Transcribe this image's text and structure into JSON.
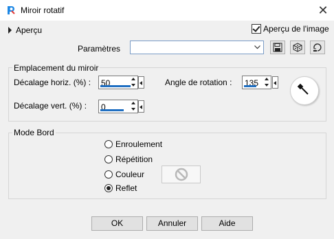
{
  "window": {
    "title": "Miroir rotatif"
  },
  "preview": {
    "label": "Aperçu",
    "image_preview_label": "Aperçu de l'image",
    "image_preview_checked": true
  },
  "parameters": {
    "label": "Paramètres",
    "value": ""
  },
  "mirror_group": {
    "title": "Emplacement du miroir",
    "horiz_label": "Décalage horiz. (%) :",
    "horiz_value": "50",
    "vert_label": "Décalage vert. (%) :",
    "vert_value": "0",
    "angle_label": "Angle de rotation :",
    "angle_value": "135"
  },
  "edge_group": {
    "title": "Mode Bord",
    "options": [
      "Enroulement",
      "Répétition",
      "Couleur",
      "Reflet"
    ],
    "selected": "Reflet"
  },
  "buttons": {
    "ok": "OK",
    "cancel": "Annuler",
    "help": "Aide"
  },
  "colors": {
    "accent": "#1f6fc2",
    "combo_border": "#7a9cc6"
  }
}
